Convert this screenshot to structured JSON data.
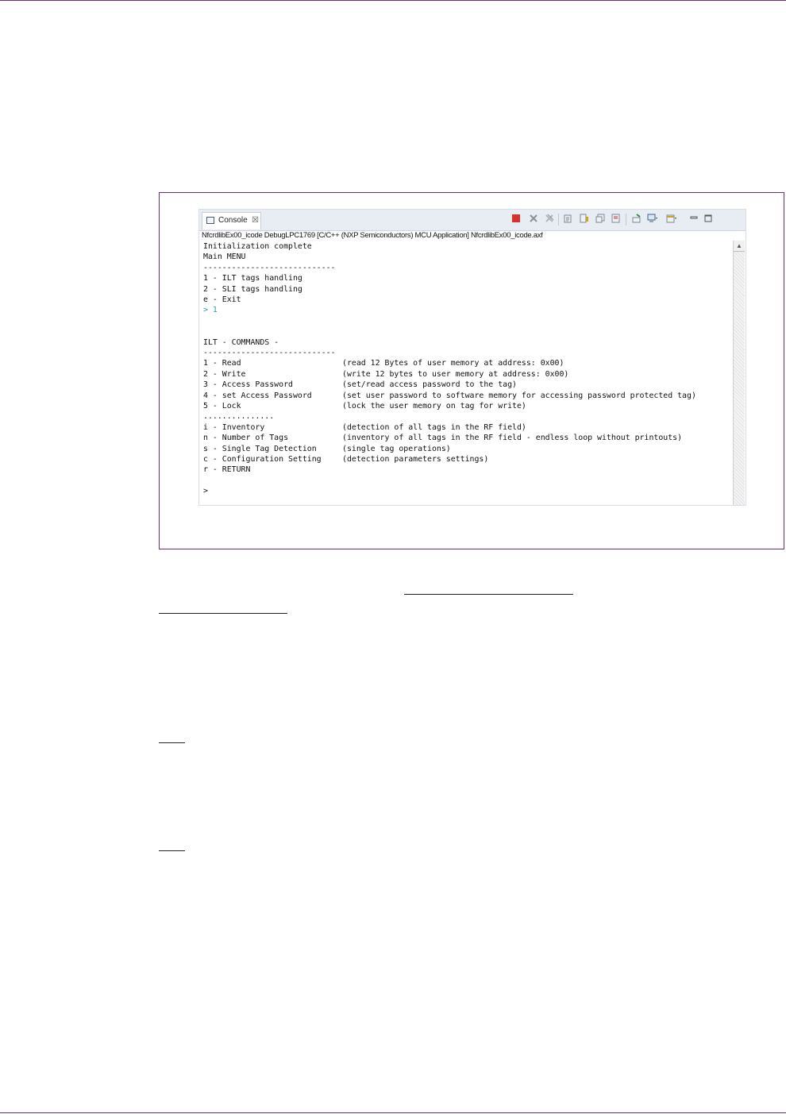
{
  "console": {
    "tab_label": "Console",
    "tab_close_glyph": "☒",
    "subtitle": "NfcrdlibEx00_icode DebugLPC1769 [C/C++ (NXP Semiconductors) MCU Application] NfcrdlibEx00_icode.axf",
    "toolbar_icons": [
      "terminate-icon",
      "remove-launch-icon",
      "remove-all-icon",
      "clear-console-icon",
      "scroll-lock-icon",
      "word-wrap-icon",
      "show-on-output-icon",
      "pin-console-icon",
      "display-selected-console-icon",
      "open-console-icon",
      "minimize-icon",
      "maximize-icon"
    ],
    "lines": [
      {
        "text": "Initialization complete"
      },
      {
        "text": "Main MENU"
      },
      {
        "text": "----------------------------"
      },
      {
        "text": "1 - ILT tags handling"
      },
      {
        "text": "2 - SLI tags handling"
      },
      {
        "text": "e - Exit"
      },
      {
        "prompt": "> ",
        "input": "1"
      },
      {
        "text": ""
      },
      {
        "text": ""
      },
      {
        "text": "ILT - COMMANDS -"
      },
      {
        "text": "----------------------------"
      },
      {
        "opt": "1 - Read",
        "desc": "(read 12 Bytes of user memory at address: 0x00)"
      },
      {
        "opt": "2 - Write",
        "desc": "(write 12 bytes to user memory at address: 0x00)"
      },
      {
        "opt": "3 - Access Password",
        "desc": "(set/read access password to the tag)"
      },
      {
        "opt": "4 - set Access Password",
        "desc": "(set user password to software memory for accessing password protected tag)"
      },
      {
        "opt": "5 - Lock",
        "desc": "(lock the user memory on tag for write)"
      },
      {
        "text": "..............."
      },
      {
        "opt": "i - Inventory",
        "desc": "(detection of all tags in the RF field)"
      },
      {
        "opt": "n - Number of Tags",
        "desc": "(inventory of all tags in the RF field - endless loop without printouts)"
      },
      {
        "opt": "s - Single Tag Detection",
        "desc": "(single tag operations)"
      },
      {
        "opt": "c - Configuration Setting",
        "desc": "(detection parameters settings)"
      },
      {
        "text": "r - RETURN"
      },
      {
        "text": ""
      },
      {
        "text": ">"
      }
    ]
  },
  "colors": {
    "accent": "#6b2c7d",
    "user_input": "#2aa198",
    "terminate": "#d9312b"
  }
}
